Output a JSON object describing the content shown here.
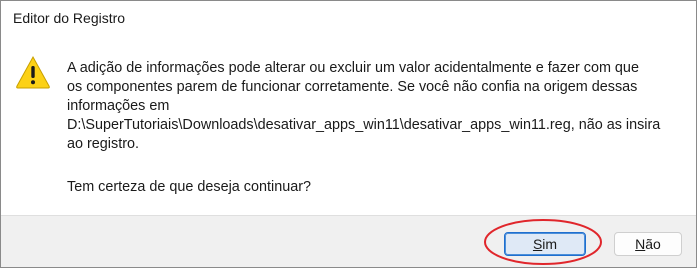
{
  "window": {
    "title": "Editor do Registro"
  },
  "dialog": {
    "icon": "warning-icon",
    "message": "A adição de informações pode alterar ou excluir um valor acidentalmente e fazer com que\nos componentes parem de funcionar corretamente. Se você não confia na origem dessas\ninformações em\nD:\\SuperTutoriais\\Downloads\\desativar_apps_win11\\desativar_apps_win11.reg, não as insira\nao registro.",
    "question": "Tem certeza de que deseja continuar?"
  },
  "buttons": {
    "yes_prefix": "S",
    "yes_rest": "im",
    "no_prefix": "N",
    "no_rest": "ão"
  },
  "colors": {
    "warning_fill": "#fcd116",
    "annotation_ring": "#e0262b",
    "primary_border": "#1f6fcf"
  }
}
